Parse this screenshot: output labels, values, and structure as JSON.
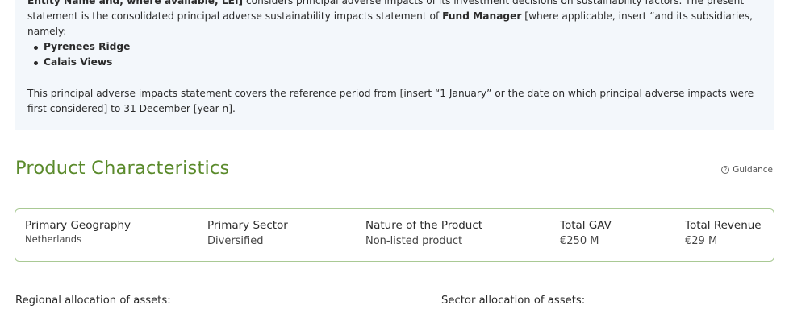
{
  "statement": {
    "line1_bold": "Entity Name and, where available, LEI]",
    "line1_rest": " considers principal adverse impacts of its investment decisions on sustainability factors. The present",
    "para1_pre": "statement is the consolidated principal adverse sustainability impacts statement of ",
    "para1_bold": "Fund Manager",
    "para1_post": " [where applicable, insert “and its subsidiaries, namely:",
    "funds": [
      "Pyrenees Ridge",
      "Calais Views"
    ],
    "para2": "This principal adverse impacts statement covers the reference period from [insert “1 January” or the date on which principal adverse impacts were first considered] to 31 December [year n]."
  },
  "product": {
    "title": "Product Characteristics",
    "guidance_label": "Guidance",
    "guidance_icon": "help-circle-icon",
    "columns": [
      {
        "label": "Primary Geography",
        "value": "Netherlands"
      },
      {
        "label": "Primary Sector",
        "value": "Diversified"
      },
      {
        "label": "Nature of the Product",
        "value": "Non-listed product"
      },
      {
        "label": "Total GAV",
        "value": "€250 M"
      },
      {
        "label": "Total Revenue",
        "value": "€29 M"
      }
    ]
  },
  "allocation": {
    "regional_heading": "Regional allocation of assets:",
    "sector_heading": "Sector allocation of assets:"
  },
  "colors": {
    "accent_green": "#5a8a2b",
    "card_border": "#a9c994",
    "statement_bg": "#f3f7fb"
  }
}
